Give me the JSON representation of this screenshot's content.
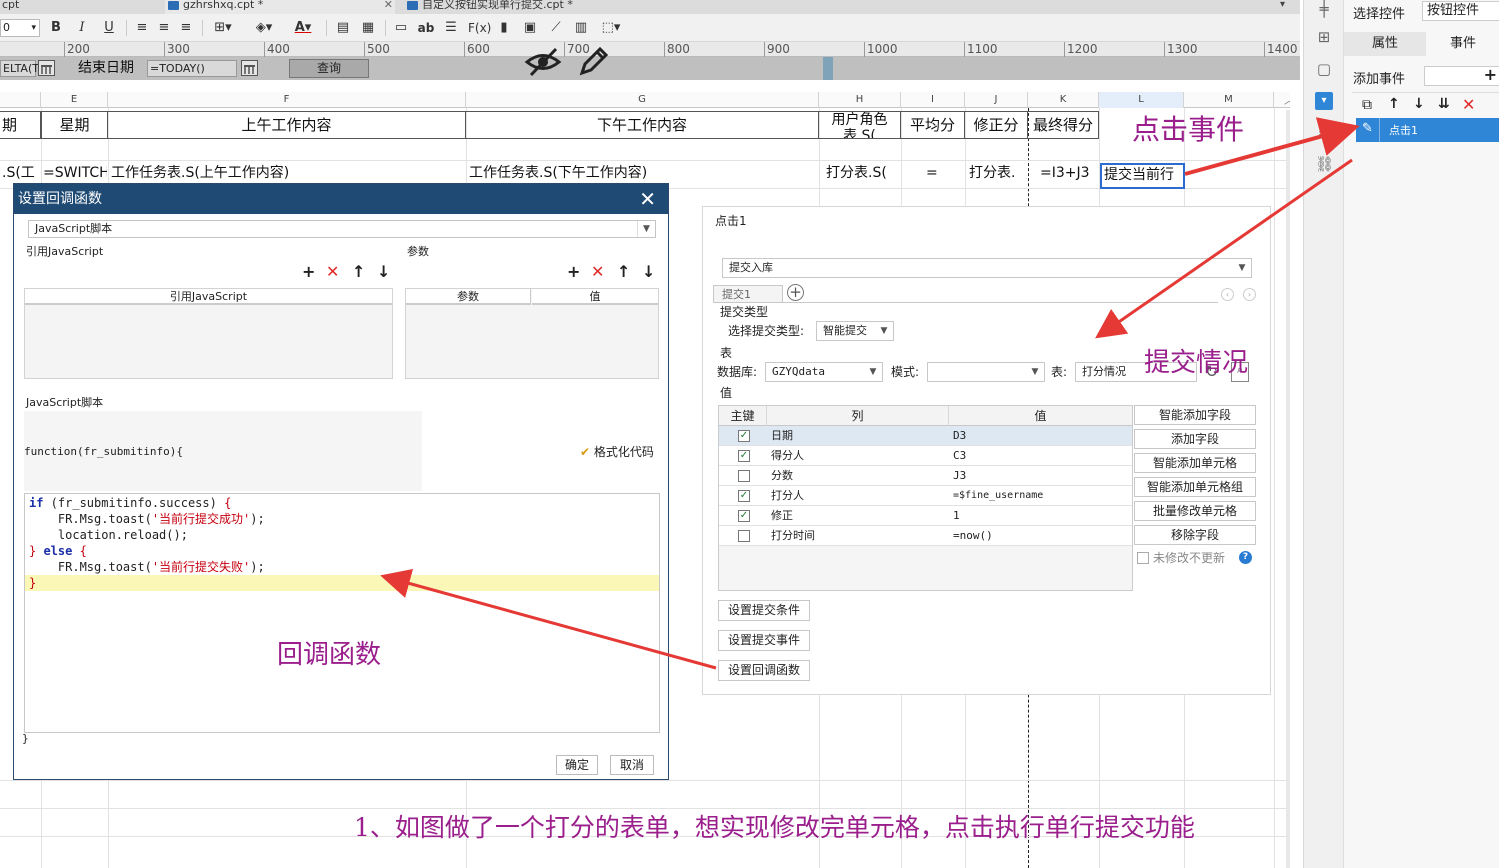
{
  "file_tabs": [
    {
      "label": "cpt",
      "closable": false
    },
    {
      "label": "gzhrshxq.cpt *",
      "closable": true
    },
    {
      "label": "自定义按钮实现单行提交.cpt *",
      "closable": false
    }
  ],
  "toolbar": {
    "font_size": "0",
    "bold": "B",
    "italic": "I",
    "underline": "U",
    "font_color": "A",
    "text_ab": "ab",
    "formula": "F(x)"
  },
  "ruler_ticks": [
    "200",
    "300",
    "400",
    "500",
    "600",
    "700",
    "800",
    "900",
    "1000",
    "1100",
    "1200",
    "1300",
    "1400"
  ],
  "param_bar": {
    "start_field": "ELTA(T",
    "end_label": "结束日期",
    "end_field": "=TODAY()",
    "query_button": "查询"
  },
  "sheet": {
    "columns": [
      "E",
      "F",
      "G",
      "H",
      "I",
      "J",
      "K",
      "L",
      "M"
    ],
    "header_row": {
      "d": "期",
      "e": "星期",
      "f": "上午工作内容",
      "g": "下午工作内容",
      "h": "用户角色表.S(",
      "i": "平均分",
      "j": "修正分",
      "k": "最终得分"
    },
    "data_row": {
      "d": ".S(工",
      "e": "=SWITCH(",
      "f": "工作任务表.S(上午工作内容)",
      "g": "工作任务表.S(下午工作内容)",
      "h": "打分表.S(",
      "i": "=",
      "j": "打分表.",
      "k": "=I3+J3",
      "l": "提交当前行"
    }
  },
  "callback_dialog": {
    "title": "设置回调函数",
    "script_type": "JavaScript脚本",
    "ref_js_label": "引用JavaScript",
    "params_label": "参数",
    "ref_js_column": "引用JavaScript",
    "param_column": "参数",
    "value_column": "值",
    "script_label": "JavaScript脚本",
    "function_signature": "function(fr_submitinfo){",
    "format_code": "格式化代码",
    "code": {
      "l1_kw": "if",
      "l1_cond": " (fr_submitinfo.success) ",
      "l1_brace": "{",
      "l2_pre": "    FR.Msg.toast(",
      "l2_str": "'当前行提交成功'",
      "l2_post": ");",
      "l3": "    location.reload();",
      "l4_brace1": "}",
      "l4_kw": " else ",
      "l4_brace2": "{",
      "l5_pre": "    FR.Msg.toast(",
      "l5_str": "'当前行提交失败'",
      "l5_post": ");",
      "l6_brace": "}"
    },
    "closing_brace": "}",
    "ok": "确定",
    "cancel": "取消"
  },
  "submit_panel": {
    "title": "点击1",
    "action": "提交入库",
    "tab": "提交1",
    "submit_type_label": "提交类型",
    "choose_type_label": "选择提交类型:",
    "submit_type_value": "智能提交",
    "table_section": "表",
    "db_label": "数据库:",
    "db_value": "GZYQdata",
    "mode_label": "模式:",
    "mode_value": "",
    "table_label": "表:",
    "table_value": "打分情况",
    "value_section": "值",
    "columns": {
      "key": "主键",
      "col": "列",
      "val": "值"
    },
    "rows": [
      {
        "key": true,
        "col": "日期",
        "val": "D3"
      },
      {
        "key": true,
        "col": "得分人",
        "val": "C3"
      },
      {
        "key": false,
        "col": "分数",
        "val": "J3"
      },
      {
        "key": true,
        "col": "打分人",
        "val": "=$fine_username"
      },
      {
        "key": true,
        "col": "修正",
        "val": "1"
      },
      {
        "key": false,
        "col": "打分时间",
        "val": "=now()"
      }
    ],
    "buttons": {
      "smart_add_field": "智能添加字段",
      "add_field": "添加字段",
      "smart_add_cell": "智能添加单元格",
      "smart_add_cell_group": "智能添加单元格组",
      "batch_modify": "批量修改单元格",
      "remove_field": "移除字段"
    },
    "no_update_unchanged": "未修改不更新",
    "set_condition": "设置提交条件",
    "set_event": "设置提交事件",
    "set_callback": "设置回调函数"
  },
  "right_panel": {
    "select_widget_label": "选择控件",
    "widget_value": "按钮控件",
    "tab_props": "属性",
    "tab_events": "事件",
    "add_event_label": "添加事件",
    "event_item": "点击1"
  },
  "annotations": {
    "click_event": "点击事件",
    "submit_status": "提交情况",
    "callback_fn": "回调函数",
    "caption": "1、如图做了一个打分的表单，想实现修改完单元格，点击执行单行提交功能"
  },
  "colors": {
    "dialog_title_bg": "#1f4a73",
    "annotation": "#9a1f8c",
    "arrow": "#e53935",
    "selected_event": "#2f86d6"
  }
}
